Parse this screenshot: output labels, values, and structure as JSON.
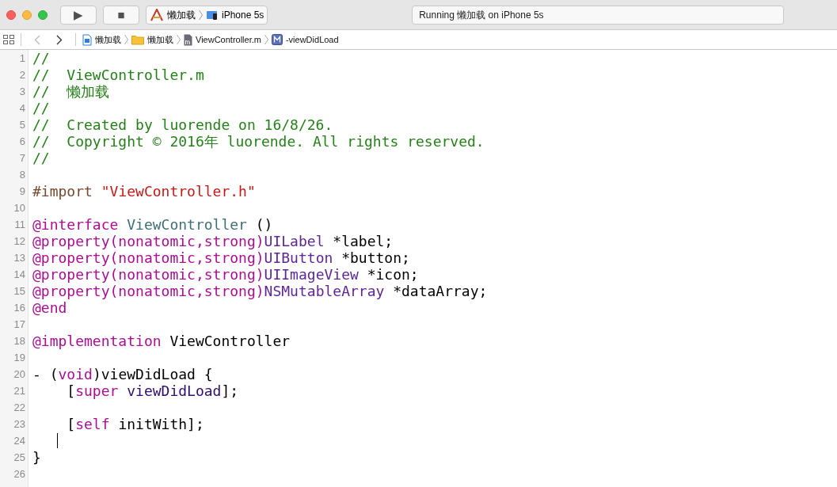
{
  "toolbar": {
    "run_button": {
      "label": "▶"
    },
    "stop_button": {
      "label": "■"
    },
    "scheme": {
      "target": "懒加载",
      "device": "iPhone 5s"
    },
    "activity": {
      "text": "Running 懒加载 on iPhone 5s"
    }
  },
  "jump_bar": {
    "back_disabled": true,
    "forward_disabled": false,
    "crumbs": [
      {
        "kind": "project",
        "text": "懒加载"
      },
      {
        "kind": "folder",
        "text": "懒加载"
      },
      {
        "kind": "file",
        "text": "ViewController.m"
      },
      {
        "kind": "method",
        "text": "-viewDidLoad"
      }
    ]
  },
  "editor": {
    "lines": [
      {
        "number": "1",
        "caret": false,
        "tokens": [
          {
            "kind": "comment",
            "text": "//"
          }
        ]
      },
      {
        "number": "2",
        "caret": false,
        "tokens": [
          {
            "kind": "comment",
            "text": "//  ViewController.m"
          }
        ]
      },
      {
        "number": "3",
        "caret": false,
        "tokens": [
          {
            "kind": "comment",
            "text": "//  懒加载"
          }
        ]
      },
      {
        "number": "4",
        "caret": false,
        "tokens": [
          {
            "kind": "comment",
            "text": "//"
          }
        ]
      },
      {
        "number": "5",
        "caret": false,
        "tokens": [
          {
            "kind": "comment",
            "text": "//  Created by luorende on 16/8/26."
          }
        ]
      },
      {
        "number": "6",
        "caret": false,
        "tokens": [
          {
            "kind": "comment",
            "text": "//  Copyright © 2016年 luorende. All rights reserved."
          }
        ]
      },
      {
        "number": "7",
        "caret": false,
        "tokens": [
          {
            "kind": "comment",
            "text": "//"
          }
        ]
      },
      {
        "number": "8",
        "caret": false
      },
      {
        "number": "9",
        "caret": false,
        "tokens": [
          {
            "kind": "preproc",
            "text": "#import "
          },
          {
            "kind": "string",
            "text": "\"ViewController.h\""
          }
        ]
      },
      {
        "number": "10",
        "caret": false
      },
      {
        "number": "11",
        "caret": false,
        "tokens": [
          {
            "kind": "keyword",
            "text": "@interface"
          },
          {
            "kind": "classname",
            "text": " ViewController"
          },
          {
            "kind": "plain",
            "text": " ()"
          }
        ]
      },
      {
        "number": "12",
        "caret": false,
        "tokens": [
          {
            "kind": "keyword",
            "text": "@property(nonatomic,strong)"
          },
          {
            "kind": "type",
            "text": "UILabel"
          },
          {
            "kind": "plain",
            "text": " *label;"
          }
        ]
      },
      {
        "number": "13",
        "caret": false,
        "tokens": [
          {
            "kind": "keyword",
            "text": "@property(nonatomic,strong)"
          },
          {
            "kind": "type",
            "text": "UIButton"
          },
          {
            "kind": "plain",
            "text": " *button;"
          }
        ]
      },
      {
        "number": "14",
        "caret": false,
        "tokens": [
          {
            "kind": "keyword",
            "text": "@property(nonatomic,strong)"
          },
          {
            "kind": "type",
            "text": "UIImageView"
          },
          {
            "kind": "plain",
            "text": " *icon;"
          }
        ]
      },
      {
        "number": "15",
        "caret": false,
        "tokens": [
          {
            "kind": "keyword",
            "text": "@property(nonatomic,strong)"
          },
          {
            "kind": "type",
            "text": "NSMutableArray"
          },
          {
            "kind": "plain",
            "text": " *dataArray;"
          }
        ]
      },
      {
        "number": "16",
        "caret": false,
        "tokens": [
          {
            "kind": "keyword",
            "text": "@end"
          }
        ]
      },
      {
        "number": "17",
        "caret": false
      },
      {
        "number": "18",
        "caret": false,
        "tokens": [
          {
            "kind": "keyword",
            "text": "@implementation"
          },
          {
            "kind": "plain",
            "text": " ViewController"
          }
        ]
      },
      {
        "number": "19",
        "caret": false
      },
      {
        "number": "20",
        "caret": false,
        "tokens": [
          {
            "kind": "plain",
            "text": "- ("
          },
          {
            "kind": "keyword",
            "text": "void"
          },
          {
            "kind": "plain",
            "text": ")viewDidLoad {"
          }
        ]
      },
      {
        "number": "21",
        "caret": false,
        "tokens": [
          {
            "kind": "plain",
            "text": "    ["
          },
          {
            "kind": "keyword",
            "text": "super"
          },
          {
            "kind": "method",
            "text": " viewDidLoad"
          },
          {
            "kind": "plain",
            "text": "];"
          }
        ]
      },
      {
        "number": "22",
        "caret": false
      },
      {
        "number": "23",
        "caret": false,
        "tokens": [
          {
            "kind": "plain",
            "text": "    ["
          },
          {
            "kind": "keyword",
            "text": "self"
          },
          {
            "kind": "plain",
            "text": " initWith];"
          }
        ]
      },
      {
        "number": "24",
        "caret": true
      },
      {
        "number": "25",
        "caret": false,
        "tokens": [
          {
            "kind": "plain",
            "text": "}"
          }
        ]
      },
      {
        "number": "26",
        "caret": false
      }
    ]
  }
}
